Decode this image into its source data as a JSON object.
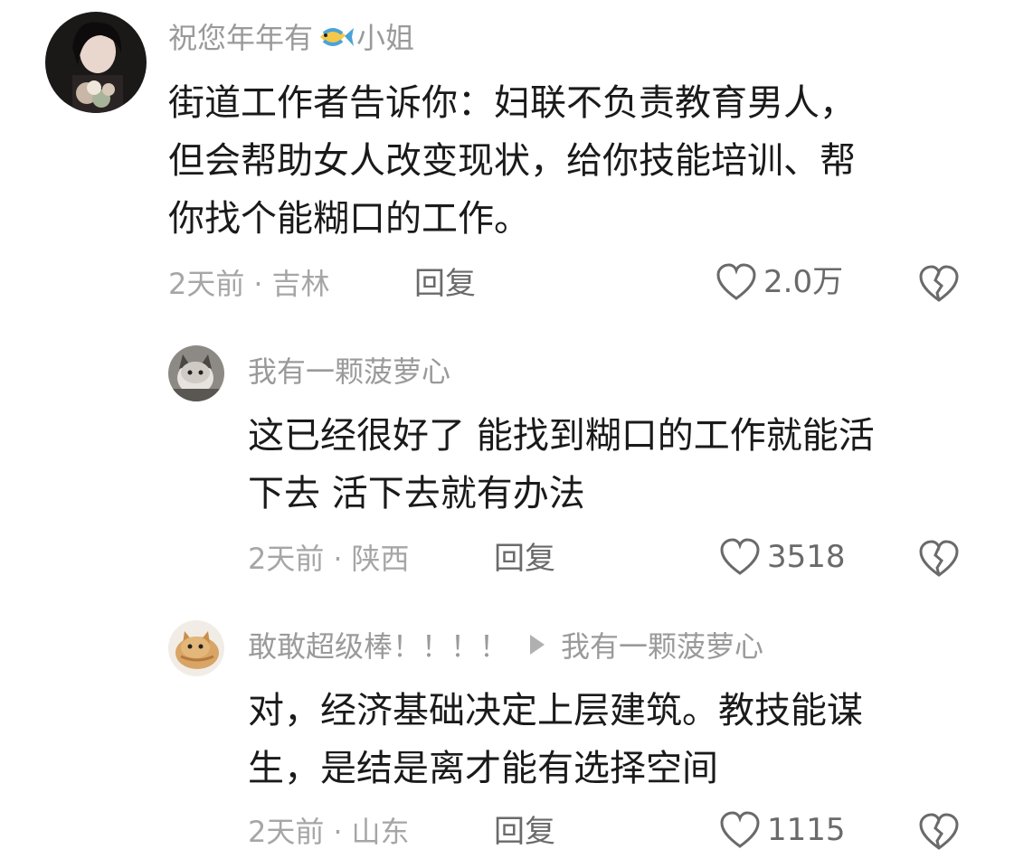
{
  "comments": [
    {
      "username_prefix": "祝您年年有",
      "username_emoji": "fish-emoji",
      "username_suffix": "小姐",
      "content_lines": [
        "街道工作者告诉你：妇联不负责教育男人，",
        "但会帮助女人改变现状，给你技能培训、帮",
        "你找个能糊口的工作。"
      ],
      "time": "2天前",
      "location": "吉林",
      "reply_label": "回复",
      "likes": "2.0万"
    },
    {
      "username": "我有一颗菠萝心",
      "content_lines": [
        "这已经很好了 能找到糊口的工作就能活",
        "下去 活下去就有办法"
      ],
      "time": "2天前",
      "location": "陕西",
      "reply_label": "回复",
      "likes": "3518"
    },
    {
      "username": "敢敢超级棒！！！！",
      "reply_to": "我有一颗菠萝心",
      "content_lines": [
        "对，经济基础决定上层建筑。教技能谋",
        "生，是结是离才能有选择空间"
      ],
      "time": "2天前",
      "location": "山东",
      "reply_label": "回复",
      "likes": "1115"
    }
  ],
  "separator": "·",
  "colors": {
    "username": "#9a9a9a",
    "content": "#1a1a1a",
    "meta": "#a6a6a6",
    "action": "#6a6a6a"
  },
  "icons": {
    "like": "heart-outline-icon",
    "dislike": "broken-heart-icon",
    "reply_arrow": "play-arrow-icon"
  }
}
